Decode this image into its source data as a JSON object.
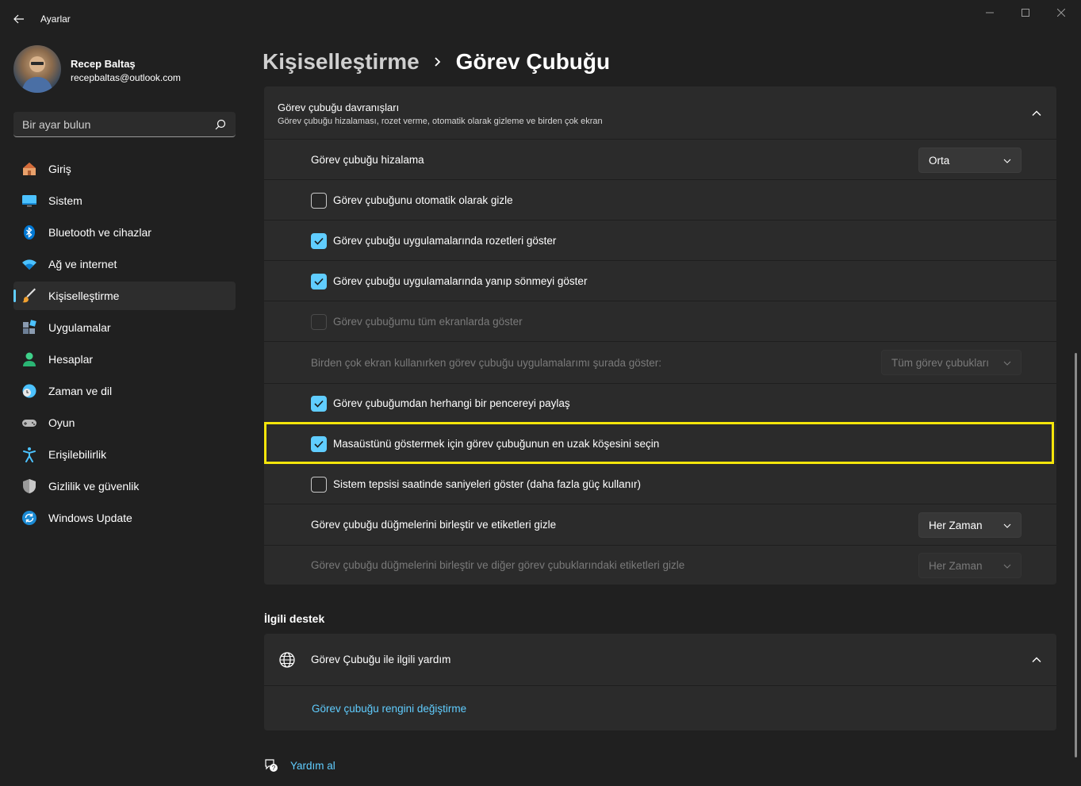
{
  "window": {
    "title": "Ayarlar"
  },
  "profile": {
    "name": "Recep Baltaş",
    "email": "recepbaltas@outlook.com"
  },
  "search": {
    "placeholder": "Bir ayar bulun"
  },
  "sidebar": {
    "items": [
      {
        "label": "Giriş",
        "icon": "home-icon"
      },
      {
        "label": "Sistem",
        "icon": "monitor-icon"
      },
      {
        "label": "Bluetooth ve cihazlar",
        "icon": "bluetooth-icon"
      },
      {
        "label": "Ağ ve internet",
        "icon": "wifi-icon"
      },
      {
        "label": "Kişiselleştirme",
        "icon": "brush-icon",
        "active": true
      },
      {
        "label": "Uygulamalar",
        "icon": "apps-icon"
      },
      {
        "label": "Hesaplar",
        "icon": "person-icon"
      },
      {
        "label": "Zaman ve dil",
        "icon": "clock-globe-icon"
      },
      {
        "label": "Oyun",
        "icon": "gamepad-icon"
      },
      {
        "label": "Erişilebilirlik",
        "icon": "accessibility-icon"
      },
      {
        "label": "Gizlilik ve güvenlik",
        "icon": "shield-icon"
      },
      {
        "label": "Windows Update",
        "icon": "update-icon"
      }
    ]
  },
  "breadcrumb": {
    "parent": "Kişiselleştirme",
    "current": "Görev Çubuğu"
  },
  "behaviors": {
    "title": "Görev çubuğu davranışları",
    "subtitle": "Görev çubuğu hizalaması, rozet verme, otomatik olarak gizleme ve birden çok ekran",
    "alignment": {
      "label": "Görev çubuğu hizalama",
      "value": "Orta"
    },
    "auto_hide": {
      "label": "Görev çubuğunu otomatik olarak gizle",
      "checked": false
    },
    "badges": {
      "label": "Görev çubuğu uygulamalarında rozetleri göster",
      "checked": true
    },
    "flashing": {
      "label": "Görev çubuğu uygulamalarında yanıp sönmeyi göster",
      "checked": true
    },
    "all_displays": {
      "label": "Görev çubuğumu tüm ekranlarda göster",
      "checked": false,
      "disabled": true
    },
    "multi_display": {
      "label": "Birden çok ekran kullanırken görev çubuğu uygulamalarımı şurada göster:",
      "value": "Tüm görev çubukları",
      "disabled": true
    },
    "share_window": {
      "label": "Görev çubuğumdan herhangi bir pencereyi paylaş",
      "checked": true
    },
    "far_corner": {
      "label": "Masaüstünü göstermek için görev çubuğunun en uzak köşesini seçin",
      "checked": true
    },
    "seconds": {
      "label": "Sistem tepsisi saatinde saniyeleri göster (daha fazla güç kullanır)",
      "checked": false
    },
    "combine": {
      "label": "Görev çubuğu düğmelerini birleştir ve etiketleri gizle",
      "value": "Her Zaman"
    },
    "combine_other": {
      "label": "Görev çubuğu düğmelerini birleştir ve diğer görev çubuklarındaki etiketleri gizle",
      "value": "Her Zaman",
      "disabled": true
    }
  },
  "related": {
    "section_title": "İlgili destek",
    "help_title": "Görev Çubuğu ile ilgili yardım",
    "link": "Görev çubuğu rengini değiştirme"
  },
  "footer": {
    "get_help": "Yardım al"
  },
  "colors": {
    "accent": "#60cdff",
    "highlight": "#f5e50b",
    "background": "#202020",
    "card": "#2b2b2b"
  }
}
